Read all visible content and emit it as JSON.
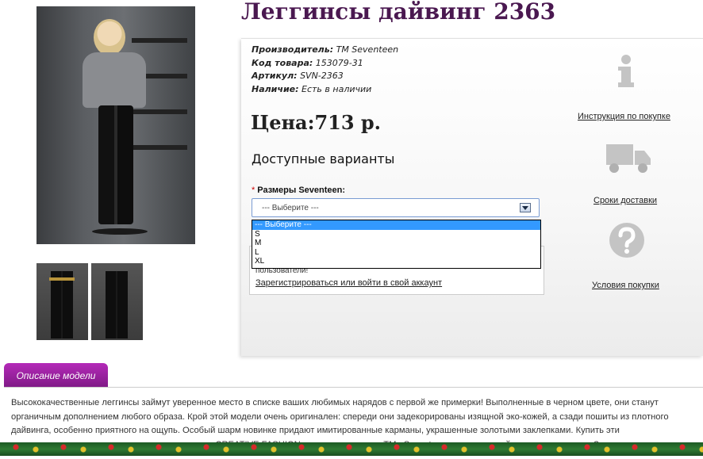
{
  "product": {
    "title": "Леггинсы дайвинг 2363",
    "meta": [
      {
        "label": "Производитель:",
        "value": "TM Seventeen"
      },
      {
        "label": "Код товара:",
        "value": "153079-31"
      },
      {
        "label": "Артикул:",
        "value": "SVN-2363"
      },
      {
        "label": "Наличие:",
        "value": "Есть в наличии"
      }
    ],
    "price": "Цена:713 р."
  },
  "variants": {
    "title": "Доступные варианты",
    "size_label": "Размеры Seventeen:",
    "required_mark": "*",
    "selected": "--- Выберите ---",
    "options": [
      "--- Выберите ---",
      "S",
      "M",
      "L",
      "XL"
    ]
  },
  "login": {
    "note": "пользователи!",
    "link": "Зарегистрироваться или войти в свой аккаунт"
  },
  "side_links": {
    "instruction": "Инструкция по покупке",
    "delivery": "Сроки доставки",
    "conditions": "Условия покупки"
  },
  "description": {
    "tab": "Описание модели",
    "lines": [
      "Высококачественные леггинсы займут уверенное место в списке ваших любимых нарядов с первой же примерки! Выполненные в черном цвете, они станут",
      "органичным дополнением любого образа. Крой этой модели очень оригинален: спереди они задекорированы изящной эко-кожей, а сзади пошиты из плотного",
      "дайвинга, особенно приятного на ощупь. Особый шарм новинке придают имитированные карманы, украшенные золотыми заклепками. Купить эти",
      "восхитительные черные леггинсы из коллекции «CREATIVE FASHION» от производителя ТМ «Seventeen» на нашем сайте можно недорого. Заказ можно"
    ]
  },
  "colors": {
    "title": "#4a1850",
    "tab": "#9b22a0",
    "select_highlight": "#3399ff"
  },
  "icons": [
    "info-icon",
    "truck-icon",
    "question-icon"
  ]
}
